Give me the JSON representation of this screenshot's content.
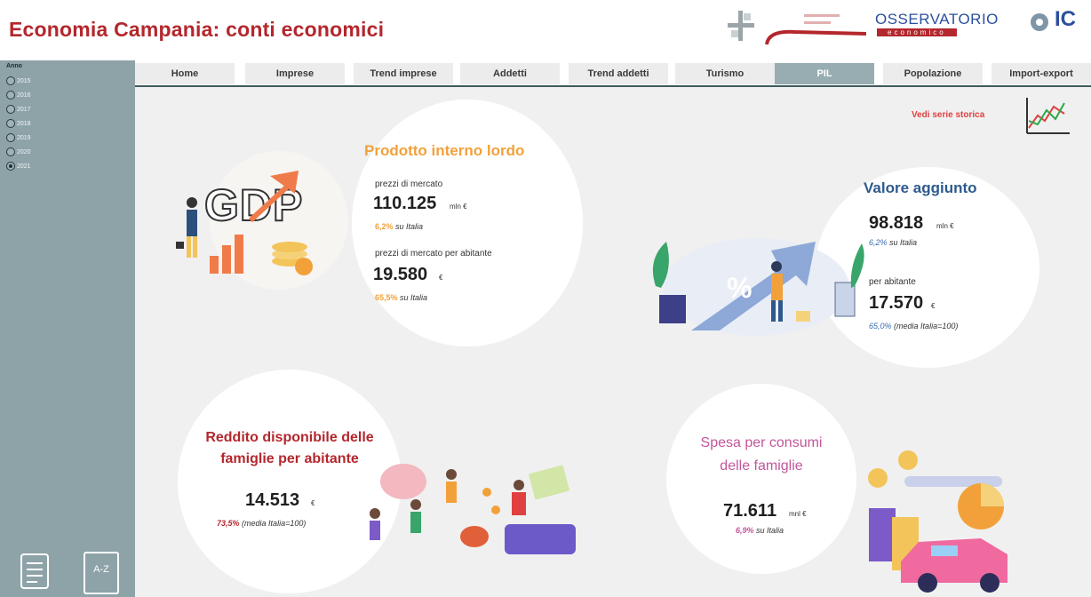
{
  "header": {
    "title": "Economia Campania: conti economici",
    "observatory": "OSSERVATORIO",
    "observatory_sub": "economico",
    "ic_mark": "IC"
  },
  "sidebar": {
    "label": "Anno",
    "years": [
      {
        "label": "2015",
        "selected": false
      },
      {
        "label": "2016",
        "selected": false
      },
      {
        "label": "2017",
        "selected": false
      },
      {
        "label": "2018",
        "selected": false
      },
      {
        "label": "2019",
        "selected": false
      },
      {
        "label": "2020",
        "selected": false
      },
      {
        "label": "2021",
        "selected": true
      }
    ],
    "icons": [
      "notebook-icon",
      "a-z-dictionary-icon"
    ],
    "az_label": "A-Z"
  },
  "nav": {
    "tabs": [
      {
        "label": "Home"
      },
      {
        "label": "Imprese"
      },
      {
        "label": "Trend imprese"
      },
      {
        "label": "Addetti"
      },
      {
        "label": "Trend addetti"
      },
      {
        "label": "Turismo"
      },
      {
        "label": "PIL",
        "active": true
      },
      {
        "label": "Popolazione"
      },
      {
        "label": "Import-export"
      }
    ]
  },
  "serie_storica": {
    "label": "Vedi serie storica"
  },
  "pil": {
    "title": "Prodotto interno lordo",
    "gdp_word": "GDP",
    "mercato_label": "prezzi di mercato",
    "mercato_value": "110.125",
    "mercato_unit": "mln €",
    "mercato_pct": "6,2%",
    "mercato_pct_suffix": "su Italia",
    "abitante_label": "prezzi di mercato per abitante",
    "abitante_value": "19.580",
    "abitante_unit": "€",
    "abitante_pct": "65,5%",
    "abitante_pct_suffix": "su Italia"
  },
  "valore_aggiunto": {
    "title": "Valore aggiunto",
    "value": "98.818",
    "unit": "mln €",
    "pct": "6,2%",
    "pct_suffix": "su Italia",
    "abitante_label": "per abitante",
    "abitante_value": "17.570",
    "abitante_unit": "€",
    "abitante_pct": "65,0%",
    "abitante_pct_suffix": "(media Italia=100)",
    "percent_symbol": "%"
  },
  "reddito": {
    "title_line1": "Reddito disponibile delle",
    "title_line2": "famiglie per abitante",
    "value": "14.513",
    "unit": "€",
    "pct": "73,5%",
    "pct_suffix": "(media Italia=100)"
  },
  "spesa": {
    "title_line1": "Spesa per consumi",
    "title_line2": "delle famiglie",
    "value": "71.611",
    "unit": "mnl €",
    "pct": "6,9%",
    "pct_suffix": "su Italia"
  },
  "colors": {
    "red": "#b3272d",
    "orange": "#f2a13a",
    "navy": "#2d5a8e",
    "blue": "#3a6ab0",
    "pink": "#c2569a",
    "sidebar": "#8ea3a8"
  }
}
